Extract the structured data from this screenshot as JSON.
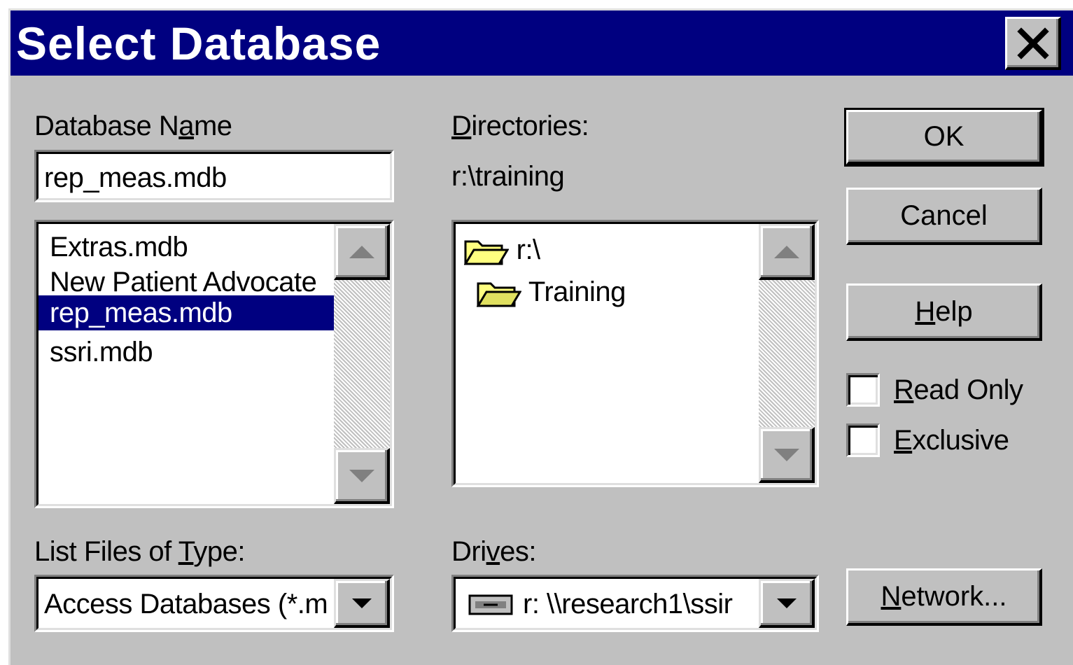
{
  "window": {
    "title": "Select Database",
    "close_icon": "close-icon"
  },
  "database_name": {
    "label_before": "Database N",
    "label_ul": "a",
    "label_after": "me",
    "value": "rep_meas.mdb"
  },
  "file_list": {
    "items": [
      "Extras.mdb",
      "New Patient Advocate",
      "rep_meas.mdb",
      "ssri.mdb"
    ],
    "selected_index": 2
  },
  "directories": {
    "label_ul": "D",
    "label_after": "irectories:",
    "current_path": "r:\\training",
    "items": [
      {
        "label": "r:\\",
        "icon": "open-folder-icon"
      },
      {
        "label": "Training",
        "icon": "open-folder-icon"
      }
    ]
  },
  "buttons": {
    "ok": "OK",
    "cancel": "Cancel",
    "help_ul": "H",
    "help_after": "elp",
    "network_ul": "N",
    "network_after": "etwork..."
  },
  "options": {
    "read_only_ul": "R",
    "read_only_after": "ead Only",
    "read_only_checked": false,
    "exclusive_ul": "E",
    "exclusive_after": "xclusive",
    "exclusive_checked": false
  },
  "file_type": {
    "label_before": "List Files of ",
    "label_ul": "T",
    "label_after": "ype:",
    "value": "Access Databases (*.m"
  },
  "drives": {
    "label_before": "Dri",
    "label_ul": "v",
    "label_after": "es:",
    "value": "r: \\\\research1\\ssir",
    "icon": "network-drive-icon"
  },
  "colors": {
    "titlebar": "#000080",
    "face": "#c0c0c0",
    "selection": "#000080",
    "folder": "#ffff80"
  }
}
